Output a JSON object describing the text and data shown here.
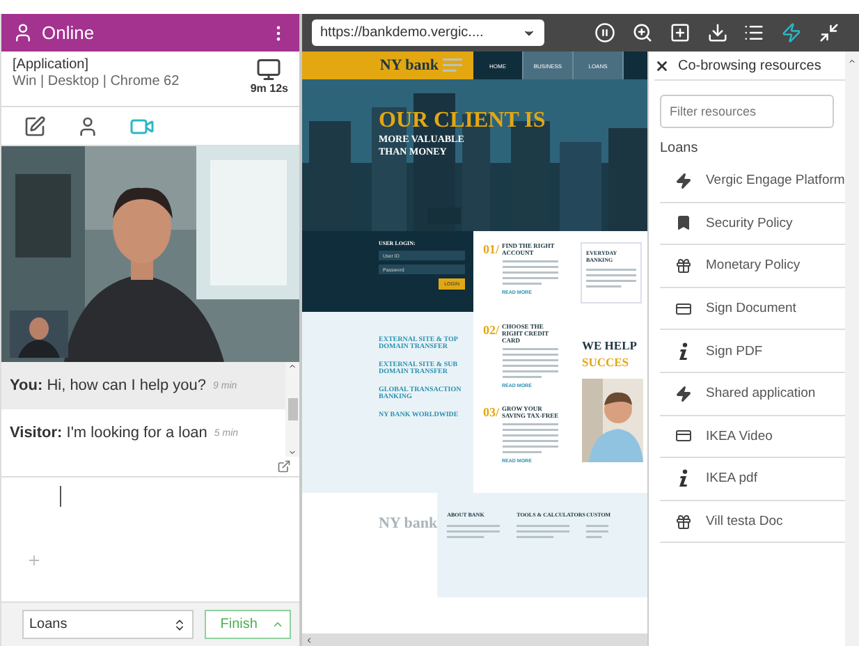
{
  "agent_panel": {
    "status": "Online",
    "visitor": {
      "name": "[Application]",
      "details": "Win | Desktop | Chrome 62",
      "duration": "9m 12s"
    },
    "tabs": [
      {
        "kind": "note",
        "selected": false
      },
      {
        "kind": "person",
        "selected": false
      },
      {
        "kind": "video",
        "selected": true
      }
    ],
    "messages": [
      {
        "sender": "You:",
        "text": "Hi, how can I help you?",
        "time": "9 min"
      },
      {
        "sender": "Visitor:",
        "text": "I'm looking for a loan",
        "time": "5 min"
      }
    ],
    "category": "Loans",
    "finish": "Finish"
  },
  "browser": {
    "url": "https://bankdemo.vergic....",
    "tools": [
      {
        "kind": "pause",
        "selected": false
      },
      {
        "kind": "zoom",
        "selected": false
      },
      {
        "kind": "area",
        "selected": false
      },
      {
        "kind": "download",
        "selected": false
      },
      {
        "kind": "list",
        "selected": false
      },
      {
        "kind": "bolt",
        "selected": true
      },
      {
        "kind": "shrink",
        "selected": false
      }
    ]
  },
  "site": {
    "brand": "NY bank",
    "nav": [
      {
        "label": "HOME",
        "selected": true
      },
      {
        "label": "BUSINESS",
        "selected": false
      },
      {
        "label": "LOANS",
        "selected": false
      }
    ],
    "hero": {
      "title": "OUR CLIENT IS",
      "subtitle": "MORE VALUABLE THAN MONEY"
    },
    "login": {
      "title": "USER LOGIN:",
      "fields": [
        "User ID",
        "Password"
      ],
      "button": "LOGIN"
    },
    "steps": [
      {
        "number": "01/",
        "title": "FIND THE RIGHT ACCOUNT",
        "link": "READ MORE"
      },
      {
        "number": "02/",
        "title": "CHOOSE THE RIGHT CREDIT CARD",
        "link": "READ MORE"
      },
      {
        "number": "03/",
        "title": "GROW YOUR SAVING TAX-FREE",
        "link": "READ MORE"
      }
    ],
    "card": "EVERYDAY BANKING",
    "links": [
      "EXTERNAL SITE & TOP DOMAIN TRANSFER",
      "EXTERNAL SITE & SUB DOMAIN TRANSFER",
      "GLOBAL TRANSACTION BANKING",
      "NY BANK WORLDWIDE"
    ],
    "promo": [
      "WE HELP",
      "SUCCES"
    ],
    "footer": {
      "brand": "NY bank",
      "columns": [
        "ABOUT BANK",
        "TOOLS & CALCULATORS",
        "CUSTOM"
      ]
    }
  },
  "resources": {
    "title": "Co-browsing resources",
    "placeholder": "Filter resources",
    "group": "Loans",
    "items": [
      {
        "kind": "bolt",
        "label": "Vergic Engage Platform"
      },
      {
        "kind": "bookmark",
        "label": "Security Policy"
      },
      {
        "kind": "gift",
        "label": "Monetary Policy"
      },
      {
        "kind": "card",
        "label": "Sign Document"
      },
      {
        "kind": "info",
        "label": "Sign PDF"
      },
      {
        "kind": "bolt",
        "label": "Shared application"
      },
      {
        "kind": "card",
        "label": "IKEA Video"
      },
      {
        "kind": "info",
        "label": "IKEA pdf"
      },
      {
        "kind": "gift",
        "label": "Vill testa Doc"
      }
    ]
  }
}
